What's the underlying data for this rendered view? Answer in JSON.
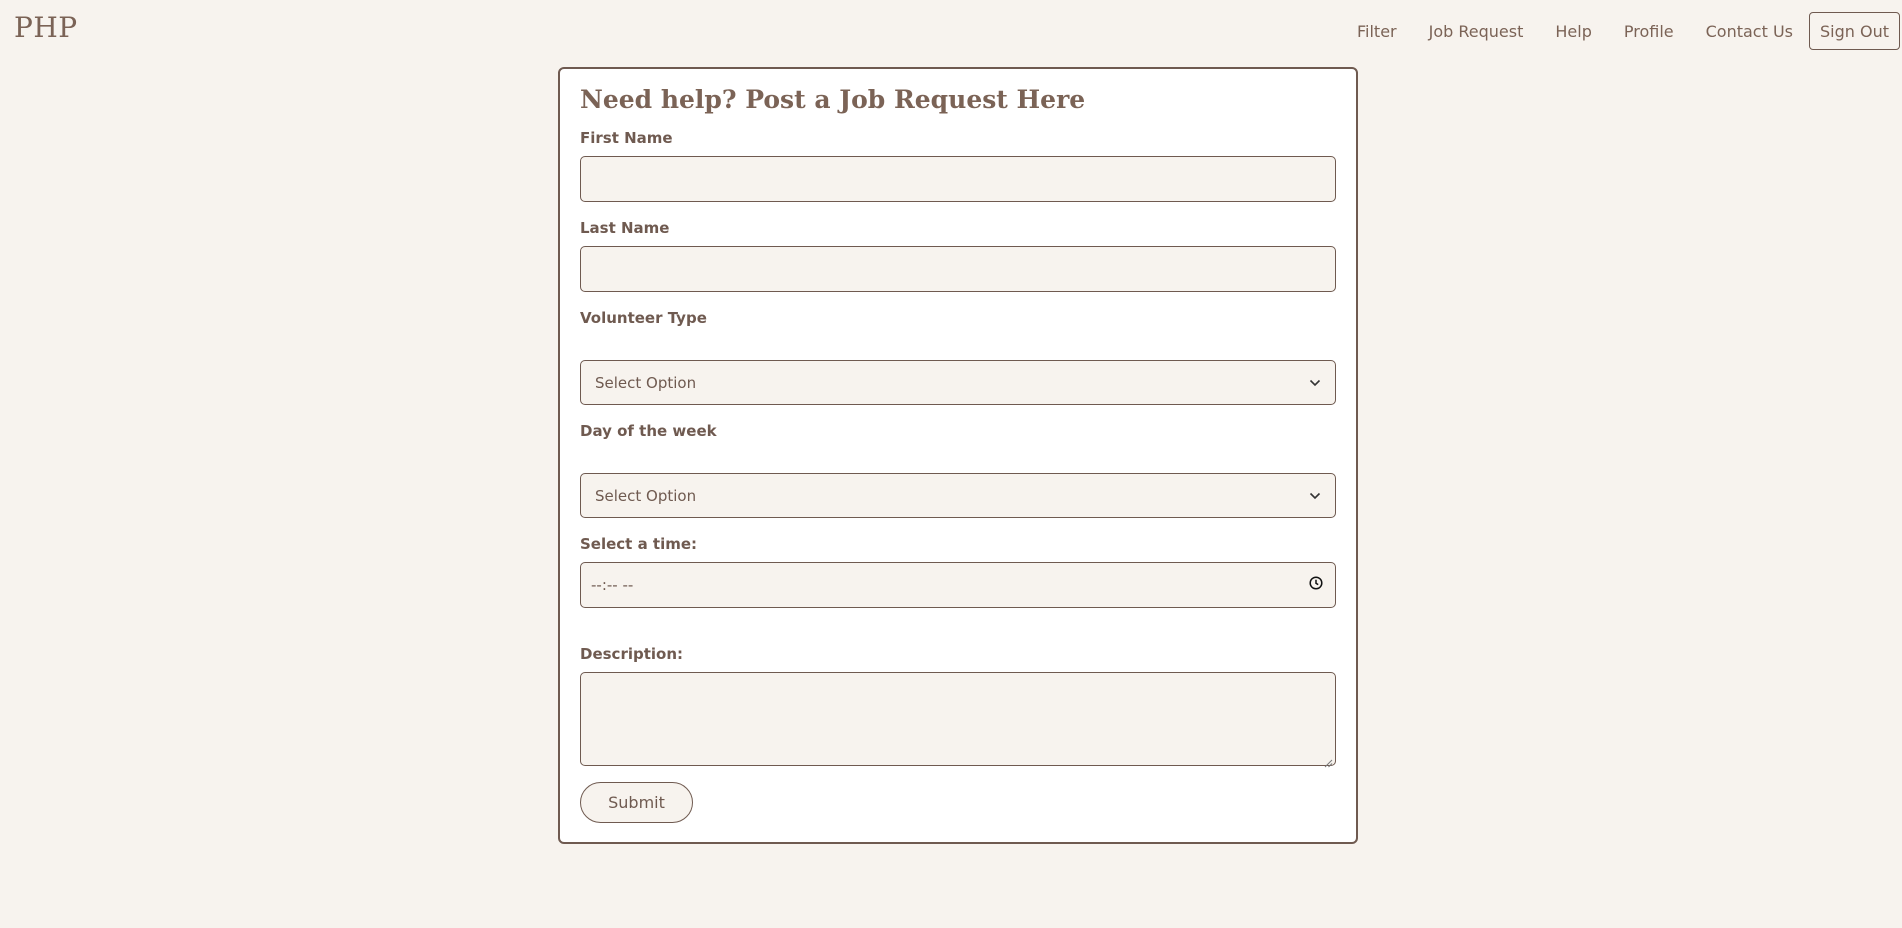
{
  "brand": "PHP",
  "nav": {
    "links": [
      "Filter",
      "Job Request",
      "Help",
      "Profile",
      "Contact Us"
    ],
    "signout_label": "Sign Out"
  },
  "form": {
    "title": "Need help? Post a Job Request Here",
    "first_name_label": "First Name",
    "first_name_value": "",
    "last_name_label": "Last Name",
    "last_name_value": "",
    "volunteer_type_label": "Volunteer Type",
    "volunteer_type_selected": "Select Option",
    "day_label": "Day of the week",
    "day_selected": "Select Option",
    "time_label": "Select a time:",
    "time_value": "--:-- --",
    "description_label": "Description:",
    "description_value": "",
    "submit_label": "Submit"
  },
  "icons": {
    "select_arrow": "chevron-down-icon",
    "time_picker": "clock-icon",
    "textarea_resize": "resize-grip-icon"
  },
  "colors": {
    "page_background": "#f7f3ee",
    "accent": "#6f5a50",
    "card_background": "#ffffff"
  }
}
